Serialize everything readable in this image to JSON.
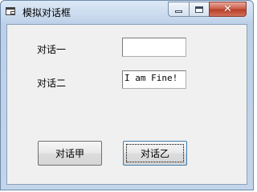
{
  "window": {
    "title": "模拟对话框",
    "icon": "application-window-icon",
    "controls": {
      "minimize": "minimize-icon",
      "maximize": "maximize-icon",
      "close": "close-icon",
      "close_glyph": "✕"
    }
  },
  "form": {
    "label1": "对话一",
    "label2": "对话二",
    "field1_value": "",
    "field2_value": "I am Fine!"
  },
  "buttons": {
    "btn1_label": "对话甲",
    "btn2_label": "对话乙"
  },
  "colors": {
    "title_gradient_top": "#dbe8f6",
    "client_background": "#f0f0f0",
    "close_button_red": "#c85a45"
  }
}
